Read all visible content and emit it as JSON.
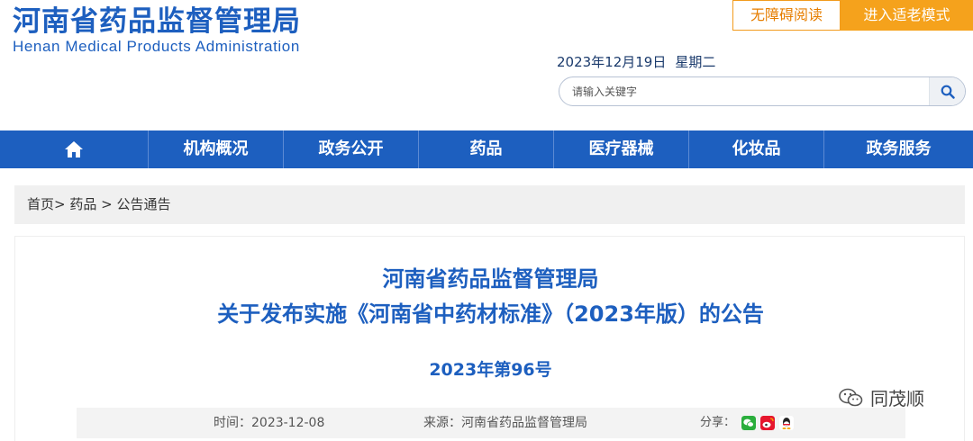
{
  "logo": {
    "title_cn": "河南省药品监督管理局",
    "title_en": "Henan Medical Products Administration"
  },
  "accessibility": {
    "barrier_free_label": "无障碍阅读",
    "elder_mode_label": "进入适老模式"
  },
  "header": {
    "date": "2023年12月19日",
    "weekday": "星期二"
  },
  "search": {
    "placeholder": "请输入关键字",
    "value": ""
  },
  "nav": {
    "home_icon": "home-icon",
    "items": [
      {
        "label": "机构概况"
      },
      {
        "label": "政务公开"
      },
      {
        "label": "药品"
      },
      {
        "label": "医疗器械"
      },
      {
        "label": "化妆品"
      },
      {
        "label": "政务服务"
      }
    ]
  },
  "breadcrumb": {
    "items": [
      "首页",
      "药品",
      "公告通告"
    ],
    "separator_1": ">",
    "separator_2": ">"
  },
  "article": {
    "title_line1": "河南省药品监督管理局",
    "title_line2": "关于发布实施《河南省中药材标准》（2023年版）的公告",
    "doc_number": "2023年第96号",
    "time": "时间：2023-12-08",
    "source": "来源：河南省药品监督管理局",
    "share_label": "分享：",
    "share_icons": [
      "wechat-icon",
      "weibo-icon",
      "qq-icon"
    ]
  },
  "watermark": {
    "text": "同茂顺"
  },
  "colors": {
    "brand_blue": "#1d5fbf",
    "accent_orange": "#f5a21c",
    "breadcrumb_bg": "#f0f0f0"
  }
}
